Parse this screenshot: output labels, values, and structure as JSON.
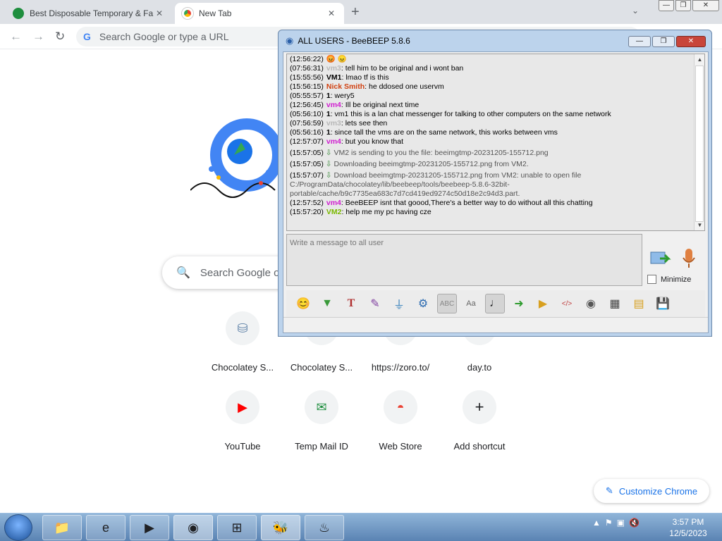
{
  "browser": {
    "tabs": [
      {
        "title": "Best Disposable Temporary & Fa",
        "close": "✕",
        "favicon_color": "#1e8e3e"
      },
      {
        "title": "New Tab",
        "close": "✕",
        "favicon_color": "#5f6368"
      }
    ],
    "new_tab": "+",
    "tab_dropdown": "⌄",
    "window_buttons": {
      "minimize": "—",
      "restore": "❐",
      "close": "✕"
    },
    "nav": {
      "back": "←",
      "forward": "→",
      "reload": "↻"
    },
    "omnibox_placeholder": "Search Google or type a URL",
    "omnibox_g": "G"
  },
  "ntp": {
    "search_placeholder": "Search Google or type a URL",
    "search_icon": "🔍",
    "shortcuts": [
      {
        "label": "Chocolatey S...",
        "icon": "⛁",
        "icon_color": "#5b7fa6"
      },
      {
        "label": "Chocolatey S...",
        "icon": "⛁",
        "icon_color": "#5b7fa6"
      },
      {
        "label": "https://zoro.to/",
        "icon": "◐",
        "icon_color": "#333333"
      },
      {
        "label": "day.to",
        "icon": "◐",
        "icon_color": "#333333"
      },
      {
        "label": "YouTube",
        "icon": "▶",
        "icon_color": "#ff0000"
      },
      {
        "label": "Temp Mail ID",
        "icon": "✉",
        "icon_color": "#1e8e3e"
      },
      {
        "label": "Web Store",
        "icon": "◓",
        "icon_color": "#ea4335"
      },
      {
        "label": "Add shortcut",
        "icon": "+",
        "icon_color": "#202124"
      }
    ],
    "customize_label": "Customize Chrome",
    "customize_icon": "✎"
  },
  "beebeep": {
    "title": "ALL USERS - BeeBEEP 5.8.6",
    "window_buttons": {
      "minimize": "—",
      "restore": "❐",
      "close": "✕"
    },
    "chat": [
      {
        "time": "(12:56:22)",
        "user": "",
        "user_color": "#000000",
        "text": "😡 😠"
      },
      {
        "time": "(07:56:31)",
        "user": "vm3",
        "user_color": "#b8b8b8",
        "text": ": tell him to be original and i wont ban"
      },
      {
        "time": "(15:55:56)",
        "user": "VM1",
        "user_color": "#000000",
        "text": ": lmao tf is this"
      },
      {
        "time": "(15:56:15)",
        "user": "Nick Smith",
        "user_color": "#d04010",
        "text": ": he ddosed one uservm"
      },
      {
        "time": "(05:55:57)",
        "user": "1",
        "user_color": "#000000",
        "text": ": wery5"
      },
      {
        "time": "(12:56:45)",
        "user": "vm4",
        "user_color": "#d020d0",
        "text": ": Ill be original next time"
      },
      {
        "time": "(05:56:10)",
        "user": "1",
        "user_color": "#000000",
        "text": ": vm1 this is a lan chat messenger for talking to other computers on the same network"
      },
      {
        "time": "(07:56:59)",
        "user": "vm3",
        "user_color": "#b8b8b8",
        "text": ": lets see then"
      },
      {
        "time": "(05:56:16)",
        "user": "1",
        "user_color": "#000000",
        "text": ": since tall the vms are on the same network, this works between vms"
      },
      {
        "time": "(12:57:07)",
        "user": "vm4",
        "user_color": "#d020d0",
        "text": ": but you know that"
      }
    ],
    "system": [
      {
        "time": "(15:57:05)",
        "text": "VM2 is sending to you the file: beeimgtmp-20231205-155712.png"
      },
      {
        "time": "(15:57:05)",
        "text": "Downloading beeimgtmp-20231205-155712.png from VM2."
      },
      {
        "time": "(15:57:07)",
        "text": "Download beeimgtmp-20231205-155712.png from VM2: unable to open file C:/ProgramData/chocolatey/lib/beebeep/tools/beebeep-5.8.6-32bit-portable/cache/b9c7735ea683c7d7cd419ed9274c50d18e2c94d3.part."
      }
    ],
    "chat_tail": [
      {
        "time": "(12:57:52)",
        "user": "vm4",
        "user_color": "#d020d0",
        "text": ": BeeBEEP isnt that goood,There's a better way to do without all this chatting"
      },
      {
        "time": "(15:57:20)",
        "user": "VM2",
        "user_color": "#7ab800",
        "text": ": help me my pc having cze"
      }
    ],
    "message_placeholder": "Write a message to all user",
    "minimize_label": "Minimize",
    "toolbar_icons": [
      "emoticons-icon",
      "bee-icon",
      "font-icon",
      "color-icon",
      "filter-icon",
      "settings-icon",
      "spellcheck-icon",
      "text-icon",
      "note-icon",
      "send-file-icon",
      "send-folder-icon",
      "html-icon",
      "screenshot-icon",
      "terminal-icon",
      "clipboard-icon",
      "save-icon"
    ]
  },
  "taskbar": {
    "clock_time": "3:57 PM",
    "clock_date": "12/5/2023"
  }
}
